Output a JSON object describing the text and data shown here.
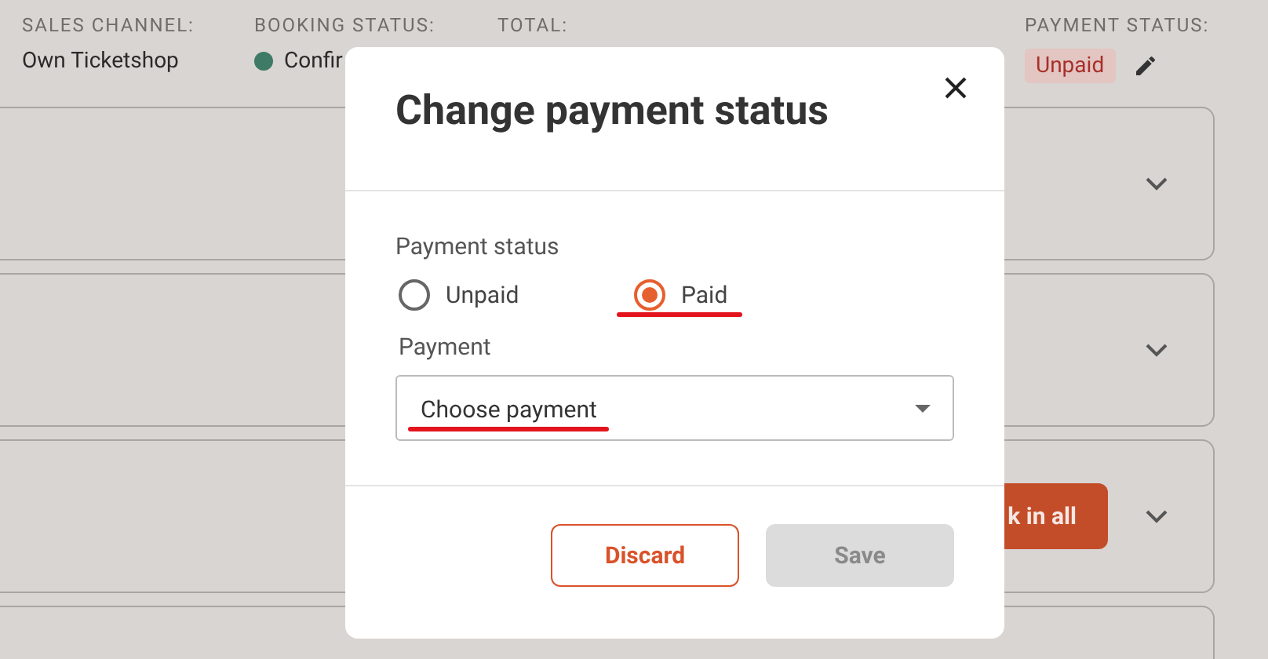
{
  "header": [
    {
      "label": "SALES CHANNEL:",
      "value": "Own Ticketshop",
      "kind": "text"
    },
    {
      "label": "BOOKING STATUS:",
      "value": "Confir",
      "kind": "status",
      "color": "#3f7a66"
    },
    {
      "label": "TOTAL:",
      "kind": "text"
    },
    {
      "label": "PAYMENT STATUS:",
      "value": "Unpaid",
      "kind": "badge"
    }
  ],
  "cards": [
    {
      "kind": "plain"
    },
    {
      "kind": "plain"
    },
    {
      "kind": "action",
      "button": "k in all"
    },
    {
      "kind": "partial"
    }
  ],
  "dialog": {
    "title": "Change payment status",
    "status_label": "Payment status",
    "options": [
      {
        "label": "Unpaid",
        "selected": false
      },
      {
        "label": "Paid",
        "selected": true
      }
    ],
    "payment_label": "Payment",
    "payment": {
      "placeholder": "Choose payment"
    },
    "buttons": [
      {
        "label": "Discard",
        "kind": "secondary",
        "disabled": false
      },
      {
        "label": "Save",
        "kind": "primary",
        "disabled": true
      }
    ]
  }
}
